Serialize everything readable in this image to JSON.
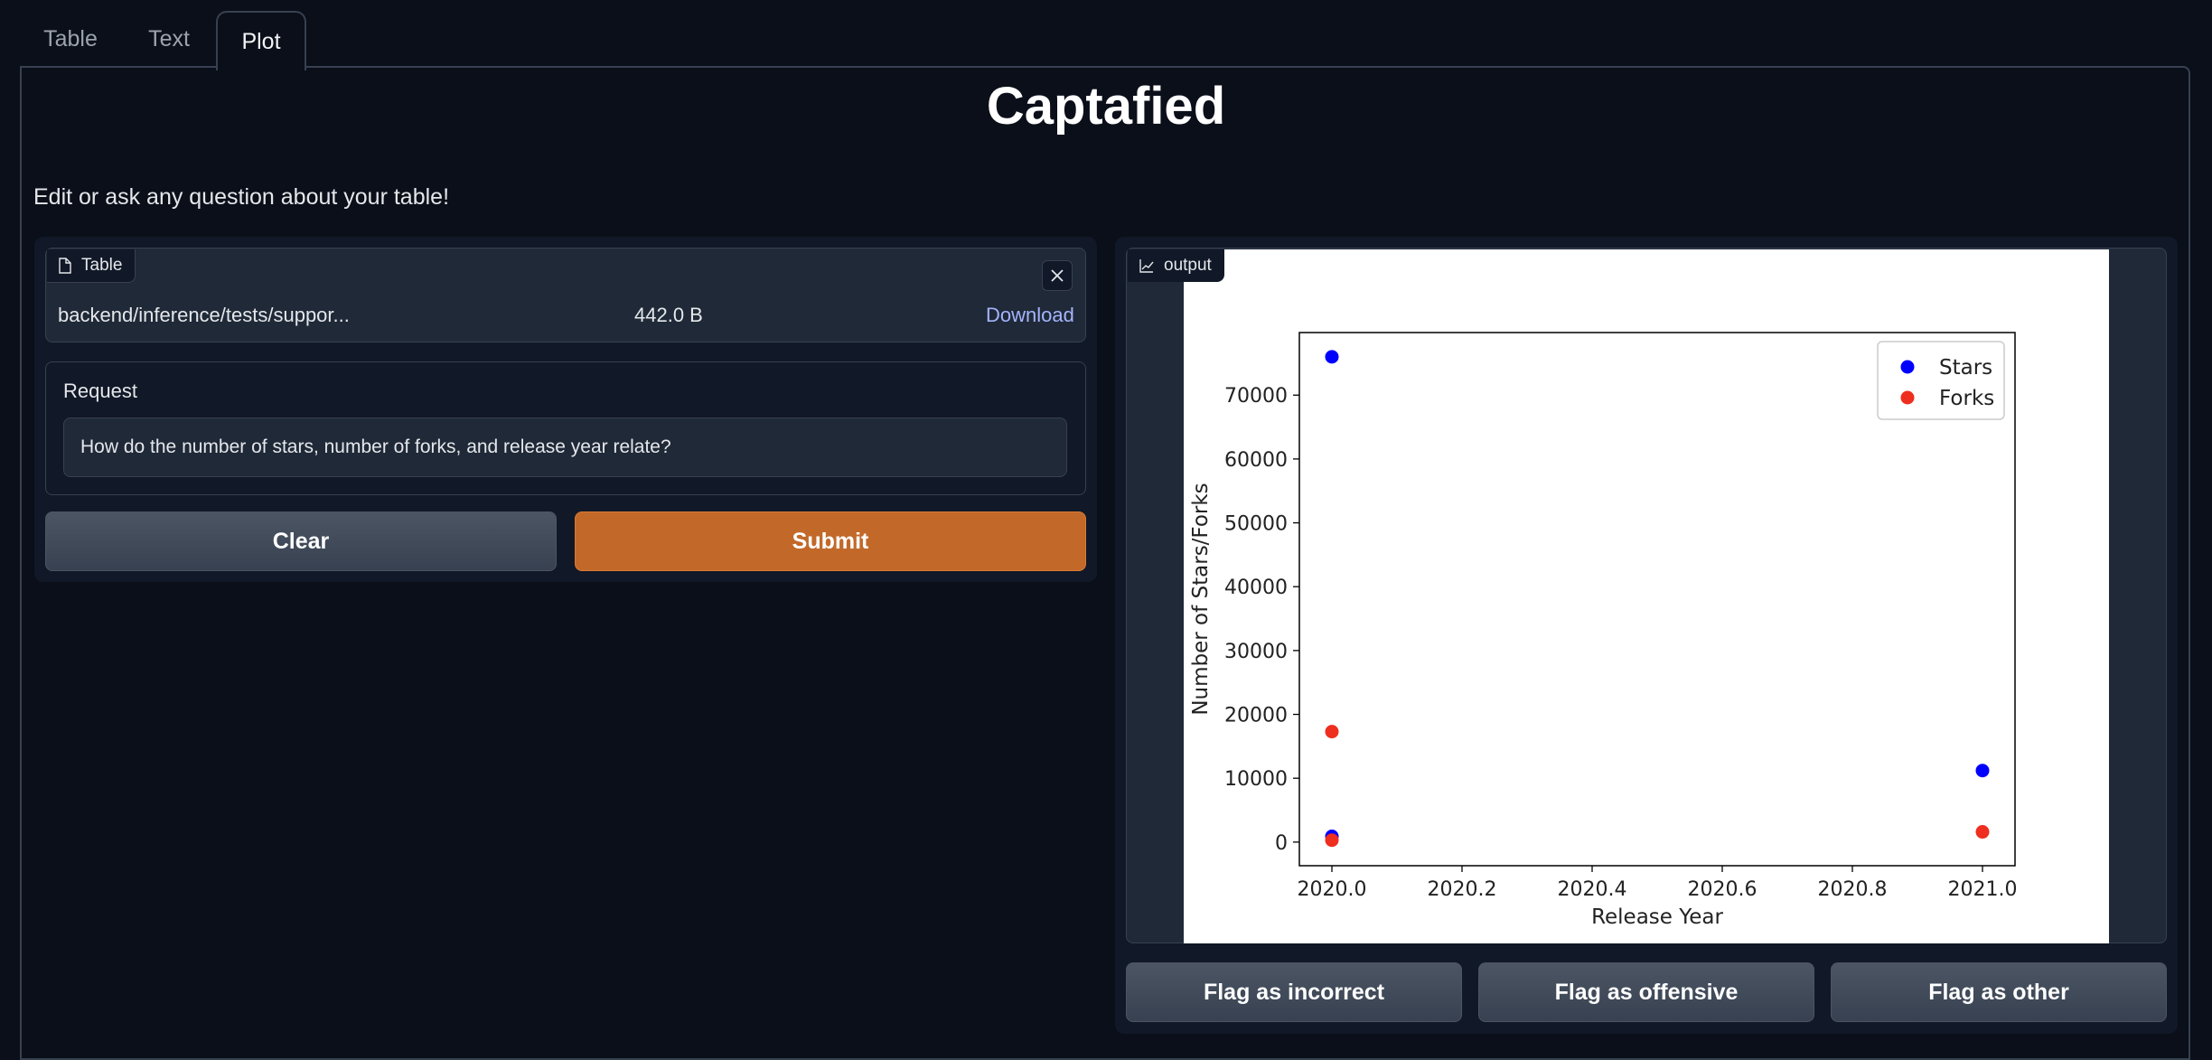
{
  "tabs": [
    {
      "label": "Table",
      "active": false
    },
    {
      "label": "Text",
      "active": false
    },
    {
      "label": "Plot",
      "active": true
    }
  ],
  "title": "Captafied",
  "description": "Edit or ask any question about your table!",
  "file": {
    "label": "Table",
    "name": "backend/inference/tests/suppor...",
    "size": "442.0 B",
    "download_label": "Download"
  },
  "request": {
    "label": "Request",
    "value": "How do the number of stars, number of forks, and release year relate?"
  },
  "buttons": {
    "clear": "Clear",
    "submit": "Submit"
  },
  "output": {
    "label": "output"
  },
  "flags": [
    "Flag as incorrect",
    "Flag as offensive",
    "Flag as other"
  ],
  "colors": {
    "accent": "#c2692a",
    "background": "#0b0f19",
    "link": "#a5b4fc"
  },
  "chart_data": {
    "type": "scatter",
    "title": "",
    "xlabel": "Release Year",
    "ylabel": "Number of Stars/Forks",
    "xlim": [
      2019.95,
      2021.05
    ],
    "ylim": [
      -3700,
      79800
    ],
    "xticks": [
      2020.0,
      2020.2,
      2020.4,
      2020.6,
      2020.8,
      2021.0
    ],
    "xtick_labels": [
      "2020.0",
      "2020.2",
      "2020.4",
      "2020.6",
      "2020.8",
      "2021.0"
    ],
    "yticks": [
      0,
      10000,
      20000,
      30000,
      40000,
      50000,
      60000,
      70000
    ],
    "ytick_labels": [
      "0",
      "10000",
      "20000",
      "30000",
      "40000",
      "50000",
      "60000",
      "70000"
    ],
    "legend_position": "top-right",
    "grid": false,
    "series": [
      {
        "name": "Stars",
        "color": "#0000ff",
        "x": [
          2020.0,
          2020.0,
          2021.0
        ],
        "y": [
          76000,
          900,
          11200
        ]
      },
      {
        "name": "Forks",
        "color": "#ee2e1e",
        "x": [
          2020.0,
          2020.0,
          2021.0
        ],
        "y": [
          17300,
          300,
          1600
        ]
      }
    ]
  }
}
